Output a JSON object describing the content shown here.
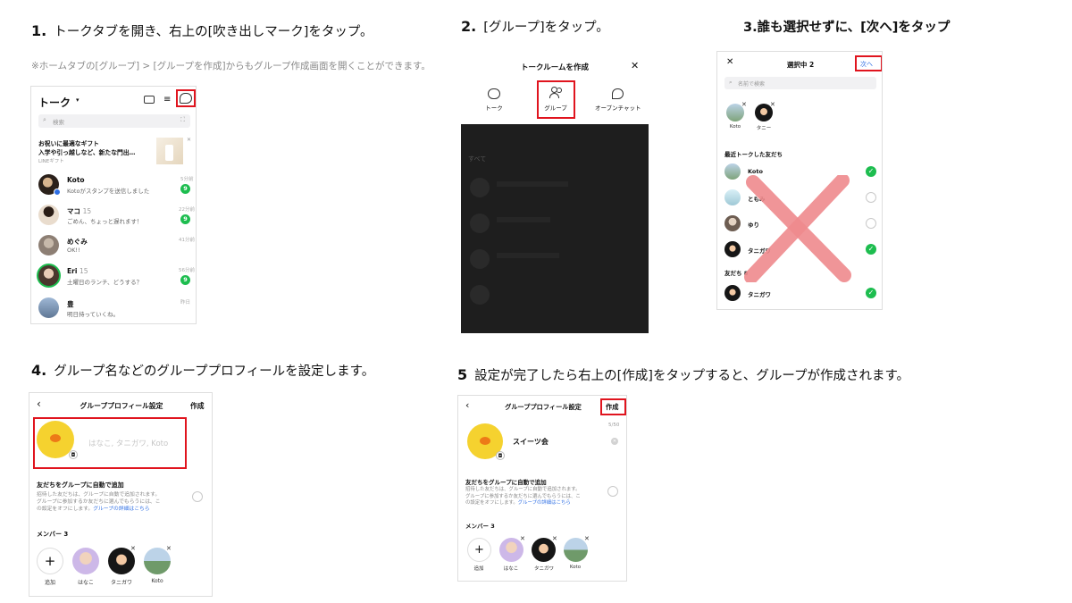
{
  "steps": {
    "s1": {
      "num": "1.",
      "text": "トークタブを開き、右上の[吹き出しマーク]をタップ。",
      "note": "※ホームタブの[グループ] > [グループを作成]からもグループ作成画面を開くことができます。"
    },
    "s2": {
      "num": "2.",
      "text": "[グループ]をタップ。"
    },
    "s3": {
      "text": "3.誰も選択せずに、[次へ]をタップ"
    },
    "s4": {
      "num": "4.",
      "text": "グループ名などのグループプロフィールを設定します。"
    },
    "s5": {
      "num": "5",
      "text": "設定が完了したら右上の[作成]をタップすると、グループが作成されます。"
    }
  },
  "screen1": {
    "title": "トーク",
    "search_placeholder": "検索",
    "ad": {
      "line1": "お祝いに最適なギフト",
      "line2": "入学や引っ越しなど、新たな門出…",
      "source": "LINEギフト"
    },
    "chats": [
      {
        "name": "Koto",
        "message": "Kotoがスタンプを送信しました",
        "time": "5分前",
        "badge": "9"
      },
      {
        "name": "マコ",
        "count": "15",
        "message": "ごめん、ちょっと遅れます！",
        "time": "22分前",
        "badge": "9"
      },
      {
        "name": "めぐみ",
        "message": "OK!!",
        "time": "41分前",
        "badge": ""
      },
      {
        "name": "Eri",
        "count": "15",
        "message": "土曜日のランチ、どうする？",
        "time": "56分前",
        "badge": "9"
      },
      {
        "name": "豊",
        "message": "明日持っていくね。",
        "time": "昨日",
        "badge": ""
      }
    ],
    "colors": {
      "green": "#1dbd4f",
      "red": "#e0141e"
    }
  },
  "screen2": {
    "title": "トークルームを作成",
    "options": [
      {
        "label": "トーク",
        "icon": "chat-bubble-icon"
      },
      {
        "label": "グループ",
        "icon": "group-icon"
      },
      {
        "label": "オープンチャット",
        "icon": "openchat-icon"
      }
    ],
    "tabs": [
      "すべて"
    ]
  },
  "screen3": {
    "header": "選択中 2",
    "next": "次へ",
    "search_placeholder": "名前で検索",
    "selected": [
      "Koto",
      "タニー"
    ],
    "section_recent": "最近トークした友だち",
    "recent": [
      {
        "name": "Koto",
        "checked": true
      },
      {
        "name": "ともみ",
        "checked": false
      },
      {
        "name": "ゆり",
        "checked": false
      },
      {
        "name": "タニガワ",
        "checked": true
      }
    ],
    "section_friends": "友だち 8",
    "friends": [
      {
        "name": "タニガワ",
        "checked": true
      }
    ]
  },
  "screen4": {
    "title": "グループプロフィール設定",
    "create": "作成",
    "name_placeholder": "はなこ, タニガワ, Koto",
    "auto_add_title": "友だちをグループに自動で追加",
    "auto_add_desc1": "招待した友だちは、グループに自動で追加されます。",
    "auto_add_desc2": "グループに参加するか友だちに選んでもらうには、こ",
    "auto_add_desc3": "の設定をオフにします。",
    "auto_add_link": "グループの詳細はこちら",
    "members_label": "メンバー 3",
    "members": [
      "追加",
      "はなこ",
      "タニガワ",
      "Koto"
    ]
  },
  "screen5": {
    "title": "グループプロフィール設定",
    "create": "作成",
    "group_name": "スイーツ会",
    "char_count": "5/50",
    "auto_add_title": "友だちをグループに自動で追加",
    "auto_add_desc1": "招待した友だちは、グループに自動で追加されます。",
    "auto_add_desc2": "グループに参加するか友だちに選んでもらうには、こ",
    "auto_add_desc3": "の設定をオフにします。",
    "auto_add_link": "グループの詳細はこちら",
    "members_label": "メンバー 3",
    "members": [
      "追加",
      "はなこ",
      "タニガワ",
      "Koto"
    ]
  }
}
